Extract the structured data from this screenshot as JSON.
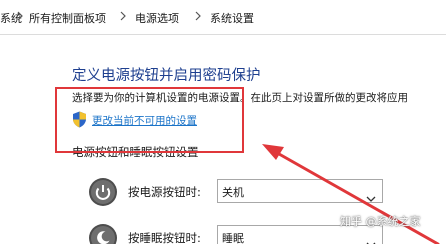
{
  "breadcrumb": {
    "items": [
      "系统",
      "所有控制面板项",
      "电源选项",
      "系统设置"
    ]
  },
  "page": {
    "title": "定义电源按钮并启用密码保护",
    "description": "选择要为你的计算机设置的电源设置。在此页上对设置所做的更改将应用",
    "change_link": "更改当前不可用的设置"
  },
  "section": {
    "title": "电源按钮和睡眠按钮设置"
  },
  "rows": [
    {
      "label": "按电源按钮时:",
      "value": "关机",
      "icon": "power-icon"
    },
    {
      "label": "按睡眠按钮时:",
      "value": "睡眠",
      "icon": "sleep-icon"
    }
  ],
  "watermark": "知乎 @系统之家",
  "colors": {
    "title": "#1e3f8f",
    "link": "#1a73c8",
    "annotation": "#e0373a"
  }
}
